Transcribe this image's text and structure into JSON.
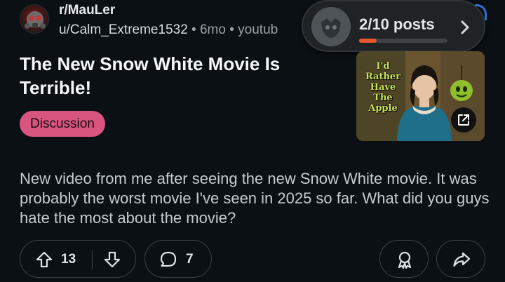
{
  "header": {
    "subreddit": "r/MauLer",
    "username": "u/Calm_Extreme1532",
    "separator": "•",
    "age": "6mo",
    "domain": "youtub"
  },
  "posts_pill": {
    "count": "2/10 posts",
    "progress_fraction": 0.2,
    "accent_color": "#e4572e"
  },
  "post": {
    "title": "The New Snow White Movie Is Terrible!",
    "flair": "Discussion",
    "flair_color": "#d7557f",
    "body": "New video from me after seeing the new Snow White movie. It was probably the worst movie I've seen in 2025 so far. What did you guys hate the most about the movie?"
  },
  "thumbnail": {
    "overlay_text": "I'd Rather Have The Apple"
  },
  "actions": {
    "score": "13",
    "comments": "7"
  },
  "icons": [
    "upvote-icon",
    "downvote-icon",
    "comment-icon",
    "award-icon",
    "share-icon",
    "external-link-icon",
    "chevron-right-icon"
  ]
}
